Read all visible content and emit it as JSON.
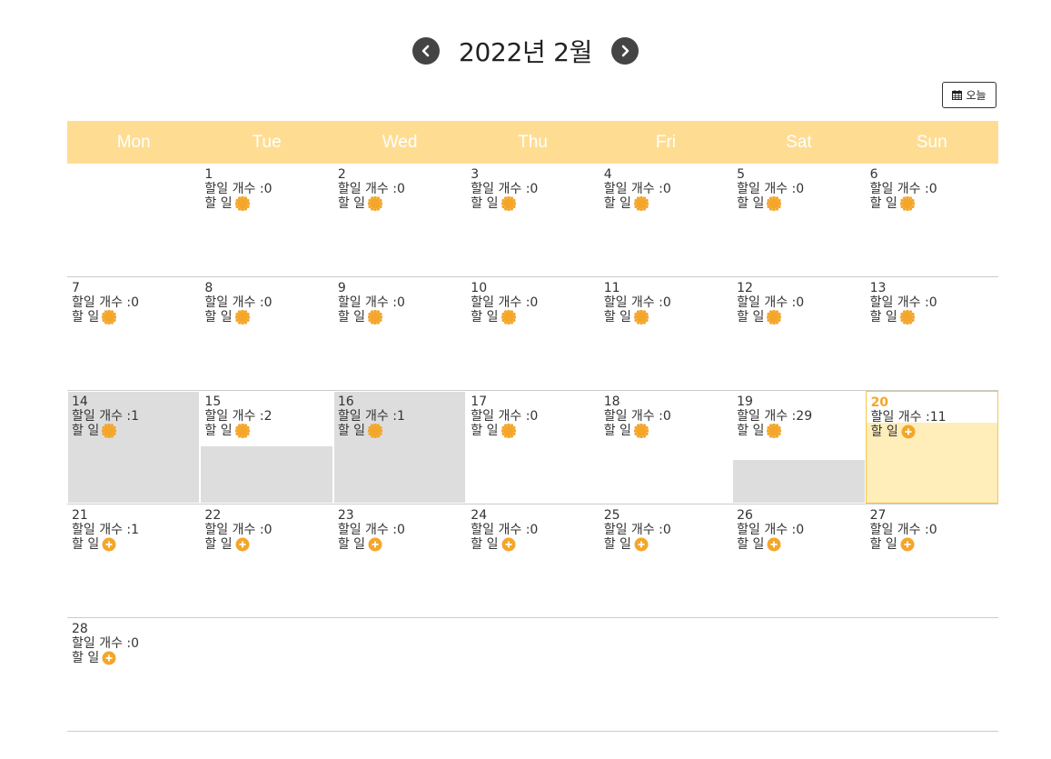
{
  "header": {
    "title": "2022년 2월",
    "prev_icon": "chevron-left-icon",
    "next_icon": "chevron-right-icon"
  },
  "toolbar": {
    "today_label": "오늘",
    "today_icon": "calendar-icon"
  },
  "calendar": {
    "weekdays": [
      "Mon",
      "Tue",
      "Wed",
      "Thu",
      "Fri",
      "Sat",
      "Sun"
    ],
    "todo_label": "할 일",
    "count_prefix": "할일 개수 :",
    "colors": {
      "header_bg": "#fedd93",
      "accent": "#f4a62a",
      "done_fill": "#dddddd",
      "today_fill": "#ffedba"
    },
    "days": [
      {
        "day": "1",
        "count": "0",
        "icon": "sun-icon"
      },
      {
        "day": "2",
        "count": "0",
        "icon": "sun-icon"
      },
      {
        "day": "3",
        "count": "0",
        "icon": "sun-icon"
      },
      {
        "day": "4",
        "count": "0",
        "icon": "sun-icon"
      },
      {
        "day": "5",
        "count": "0",
        "icon": "sun-icon"
      },
      {
        "day": "6",
        "count": "0",
        "icon": "sun-icon"
      },
      {
        "day": "7",
        "count": "0",
        "icon": "sun-icon"
      },
      {
        "day": "8",
        "count": "0",
        "icon": "sun-icon"
      },
      {
        "day": "9",
        "count": "0",
        "icon": "sun-icon"
      },
      {
        "day": "10",
        "count": "0",
        "icon": "sun-icon"
      },
      {
        "day": "11",
        "count": "0",
        "icon": "sun-icon"
      },
      {
        "day": "12",
        "count": "0",
        "icon": "sun-icon"
      },
      {
        "day": "13",
        "count": "0",
        "icon": "sun-icon"
      },
      {
        "day": "14",
        "count": "1",
        "icon": "sun-icon",
        "completion": 1.0
      },
      {
        "day": "15",
        "count": "2",
        "icon": "sun-icon",
        "completion": 0.5
      },
      {
        "day": "16",
        "count": "1",
        "icon": "sun-icon",
        "completion": 1.0
      },
      {
        "day": "17",
        "count": "0",
        "icon": "sun-icon"
      },
      {
        "day": "18",
        "count": "0",
        "icon": "sun-icon"
      },
      {
        "day": "19",
        "count": "29",
        "icon": "sun-icon",
        "completion": 0.38
      },
      {
        "day": "20",
        "count": "11",
        "icon": "plus-icon",
        "today": true,
        "completion": 0.73
      },
      {
        "day": "21",
        "count": "1",
        "icon": "plus-icon"
      },
      {
        "day": "22",
        "count": "0",
        "icon": "plus-icon"
      },
      {
        "day": "23",
        "count": "0",
        "icon": "plus-icon"
      },
      {
        "day": "24",
        "count": "0",
        "icon": "plus-icon"
      },
      {
        "day": "25",
        "count": "0",
        "icon": "plus-icon"
      },
      {
        "day": "26",
        "count": "0",
        "icon": "plus-icon"
      },
      {
        "day": "27",
        "count": "0",
        "icon": "plus-icon"
      },
      {
        "day": "28",
        "count": "0",
        "icon": "plus-icon"
      }
    ]
  }
}
